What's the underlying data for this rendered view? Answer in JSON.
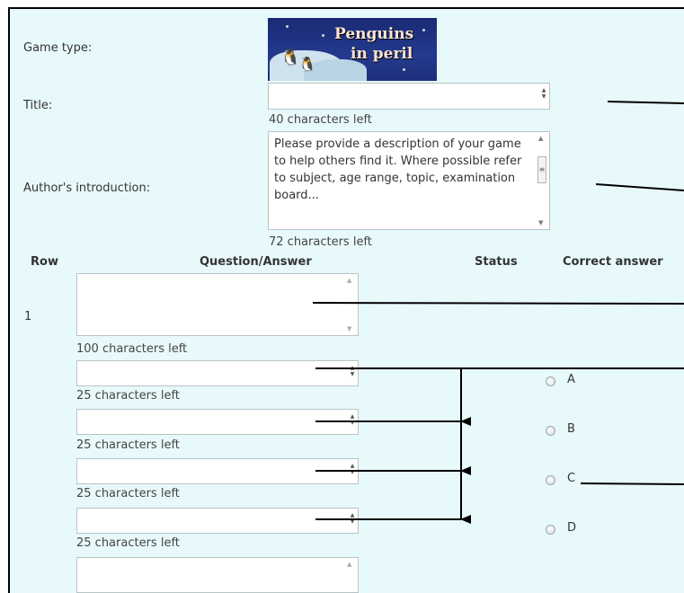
{
  "form": {
    "game_type_label": "Game type:",
    "logo_line1": "Penguins",
    "logo_line2": "in peril",
    "title_label": "Title:",
    "title_value": "",
    "title_counter": "40 characters left",
    "intro_label": "Author's introduction:",
    "intro_value": "Please provide a description of your game to help others find it. Where possible refer to subject, age range, topic, examination board...",
    "intro_counter": "72 characters left"
  },
  "table": {
    "headers": {
      "row": "Row",
      "question_answer": "Question/Answer",
      "status": "Status",
      "correct_answer": "Correct answer"
    },
    "rows": [
      {
        "number": "1",
        "question_counter": "100 characters left",
        "answers": [
          {
            "letter": "A",
            "counter": "25 characters left"
          },
          {
            "letter": "B",
            "counter": "25 characters left"
          },
          {
            "letter": "C",
            "counter": "25 characters left"
          },
          {
            "letter": "D",
            "counter": "25 characters left"
          }
        ]
      }
    ]
  },
  "colors": {
    "panel_bg": "#e8f9fb",
    "arrow": "#000000"
  }
}
